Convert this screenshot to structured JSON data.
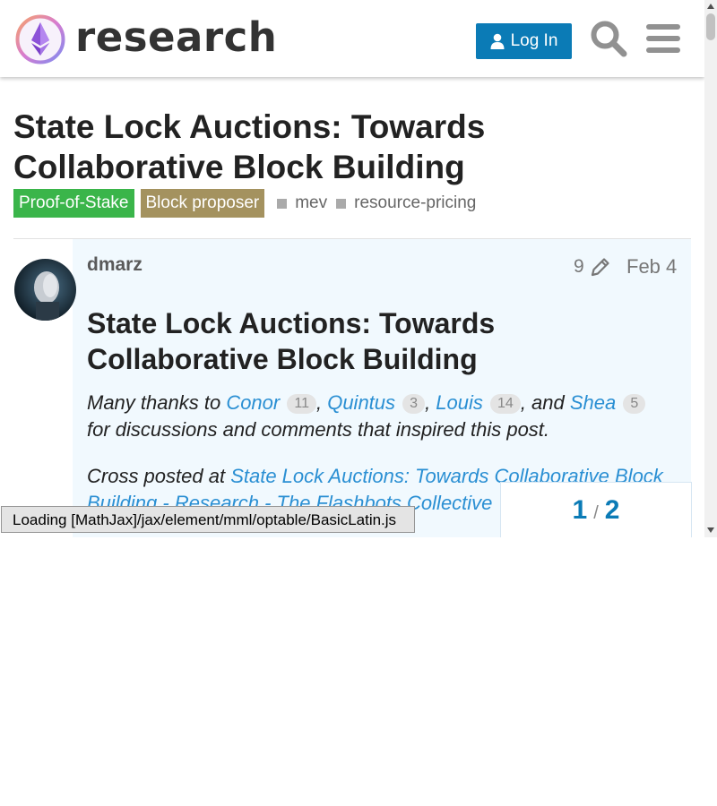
{
  "header": {
    "logo_text": "research",
    "login_label": "Log In",
    "icons": [
      "ethereum-logo-icon",
      "user-icon",
      "search-icon",
      "hamburger-menu-icon"
    ]
  },
  "topic": {
    "title": "State Lock Auctions: Towards Collaborative Block Building",
    "categories": [
      {
        "label": "Proof-of-Stake",
        "color": "#3ab54a"
      },
      {
        "label": "Block proposer",
        "color": "#a4925f"
      }
    ],
    "tags": [
      "mev",
      "resource-pricing"
    ]
  },
  "post": {
    "username": "dmarz",
    "edit_count": "9",
    "date": "Feb 4",
    "heading": "State Lock Auctions: Towards Collaborative Block Building",
    "thanks": {
      "prefix": "Many thanks to ",
      "people": [
        {
          "name": "Conor",
          "count": "11",
          "sep": ", "
        },
        {
          "name": "Quintus",
          "count": "3",
          "sep": ", "
        },
        {
          "name": "Louis",
          "count": "14",
          "sep": ", and "
        },
        {
          "name": "Shea",
          "count": "5",
          "sep": " "
        }
      ],
      "suffix": "for discussions and comments that inspired this post."
    },
    "cross_post": {
      "prefix": "Cross posted at ",
      "link_text": "State Lock Auctions: Towards Collaborative Block Building - Research - The Flashbots Collective"
    }
  },
  "progress": {
    "current": "1",
    "separator": "/",
    "total": "2"
  },
  "mathjax_message": "Loading [MathJax]/jax/element/mml/optable/BasicLatin.js",
  "colors": {
    "accent": "#0b7bb6",
    "link": "#2a8fd3",
    "post_bg": "#f1f9fe"
  }
}
